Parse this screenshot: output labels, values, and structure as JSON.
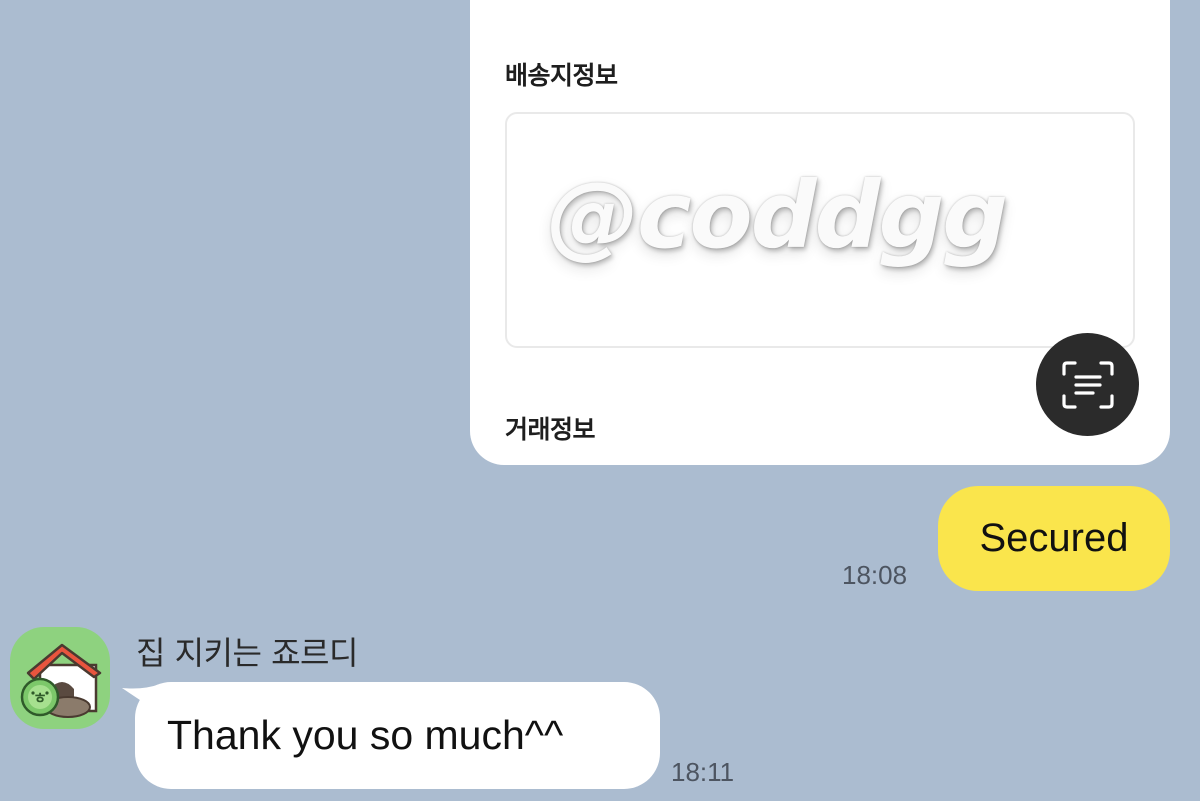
{
  "card": {
    "delivery_title": "배송지정보",
    "watermark": "@coddgg",
    "trade_title": "거래정보",
    "scan_button_icon": "text-scan-icon"
  },
  "messages": {
    "mine": {
      "text": "Secured",
      "time": "18:08",
      "bubble_color": "#fae54c"
    },
    "theirs": {
      "sender": "집 지키는 죠르디",
      "text": "Thank you so much^^",
      "time": "18:11",
      "avatar_icon": "doghouse-avatar-icon"
    }
  },
  "colors": {
    "background": "#abbcd0",
    "card": "#ffffff",
    "scan_button": "#2b2b2b"
  }
}
